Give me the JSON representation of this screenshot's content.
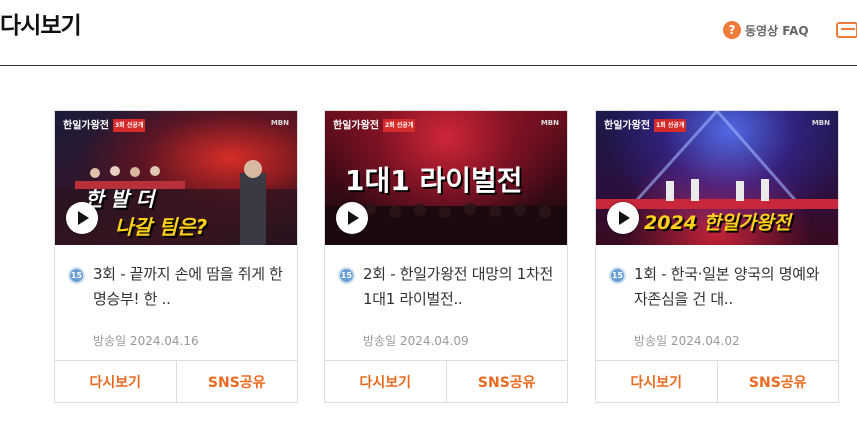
{
  "page": {
    "title": "다시보기"
  },
  "header": {
    "faq_icon_glyph": "?",
    "faq_label": "동영상 FAQ"
  },
  "cards": [
    {
      "thumb_logo": "한일가왕전",
      "thumb_logo_tag": "3회 선공개",
      "thumb_mbn": "MBN",
      "thumb_caption_line1": "한 발 더",
      "thumb_caption_line2": "나갈 팀은?",
      "age_badge": "15",
      "title": "3회 - 끝까지 손에 땀을 쥐게 한 명승부! 한 ..",
      "air_date": "방송일 2024.04.16",
      "replay_label": "다시보기",
      "share_label": "SNS공유"
    },
    {
      "thumb_logo": "한일가왕전",
      "thumb_logo_tag": "2회 선공개",
      "thumb_mbn": "MBN",
      "thumb_caption_line1": "1대1 라이벌전",
      "age_badge": "15",
      "title": "2회 - 한일가왕전 대망의 1차전 1대1 라이벌전..",
      "air_date": "방송일 2024.04.09",
      "replay_label": "다시보기",
      "share_label": "SNS공유"
    },
    {
      "thumb_logo": "한일가왕전",
      "thumb_logo_tag": "1회 선공개",
      "thumb_mbn": "MBN",
      "thumb_caption_line1": "2024 한일가왕전",
      "age_badge": "15",
      "title": "1회 - 한국·일본 양국의 명예와 자존심을 건 대..",
      "air_date": "방송일 2024.04.02",
      "replay_label": "다시보기",
      "share_label": "SNS공유"
    }
  ],
  "colors": {
    "accent": "#ea6a1f",
    "badge": "#6a9fd4",
    "faq_icon": "#f07a3a"
  },
  "icons": {
    "faq": "question-circle-icon",
    "play": "play-icon",
    "age": "age-rating-15-icon",
    "edge": "window-icon"
  }
}
